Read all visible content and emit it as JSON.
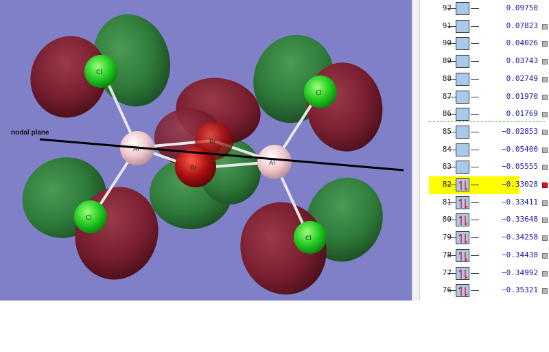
{
  "viewport": {
    "annotation": "nodal plane",
    "atoms": {
      "cl_top_left": "Cl",
      "cl_top_right": "Cl",
      "cl_bottom_left": "Cl",
      "cl_bottom_right": "Cl",
      "al_left": "Al",
      "al_right": "Al",
      "br_top": "Br",
      "br_bottom": "Br"
    },
    "colors": {
      "background": "#7f80c8",
      "lobe_positive": "#2f7a3a",
      "lobe_negative": "#7a1f30",
      "chlorine": "#22cc22",
      "aluminium": "#efc8cc",
      "bromine": "#aa1010"
    }
  },
  "orbitals": [
    {
      "number": "92",
      "energy": "0.09750",
      "occupied": false,
      "selected": false,
      "has_checkbox": false
    },
    {
      "number": "91",
      "energy": "0.07823",
      "occupied": false,
      "selected": false,
      "has_checkbox": true
    },
    {
      "number": "90",
      "energy": "0.04026",
      "occupied": false,
      "selected": false,
      "has_checkbox": true
    },
    {
      "number": "89",
      "energy": "0.03743",
      "occupied": false,
      "selected": false,
      "has_checkbox": true
    },
    {
      "number": "88",
      "energy": "0.02749",
      "occupied": false,
      "selected": false,
      "has_checkbox": true
    },
    {
      "number": "87",
      "energy": "0.01970",
      "occupied": false,
      "selected": false,
      "has_checkbox": true
    },
    {
      "number": "86",
      "energy": "0.01769",
      "occupied": false,
      "selected": false,
      "has_checkbox": true
    },
    {
      "number": "85",
      "energy": "−0.02853",
      "occupied": false,
      "selected": false,
      "has_checkbox": true
    },
    {
      "number": "84",
      "energy": "−0.05400",
      "occupied": false,
      "selected": false,
      "has_checkbox": true
    },
    {
      "number": "83",
      "energy": "−0.05555",
      "occupied": false,
      "selected": false,
      "has_checkbox": true
    },
    {
      "number": "82",
      "energy": "−0.33028",
      "occupied": true,
      "selected": true,
      "has_checkbox": true
    },
    {
      "number": "81",
      "energy": "−0.33411",
      "occupied": true,
      "selected": false,
      "has_checkbox": true
    },
    {
      "number": "80",
      "energy": "−0.33648",
      "occupied": true,
      "selected": false,
      "has_checkbox": true
    },
    {
      "number": "79",
      "energy": "−0.34258",
      "occupied": true,
      "selected": false,
      "has_checkbox": true
    },
    {
      "number": "78",
      "energy": "−0.34438",
      "occupied": true,
      "selected": false,
      "has_checkbox": true
    },
    {
      "number": "77",
      "energy": "−0.34992",
      "occupied": true,
      "selected": false,
      "has_checkbox": true
    },
    {
      "number": "76",
      "energy": "−0.35321",
      "occupied": true,
      "selected": false,
      "has_checkbox": true
    }
  ],
  "colors": {
    "selected_highlight": "#ffff00",
    "orbital_box": "#a9c8ea",
    "energy_text": "#1a1aa0",
    "electron_arrows": "#dd1111",
    "homo_lumo_separator": "#2aa02a"
  }
}
